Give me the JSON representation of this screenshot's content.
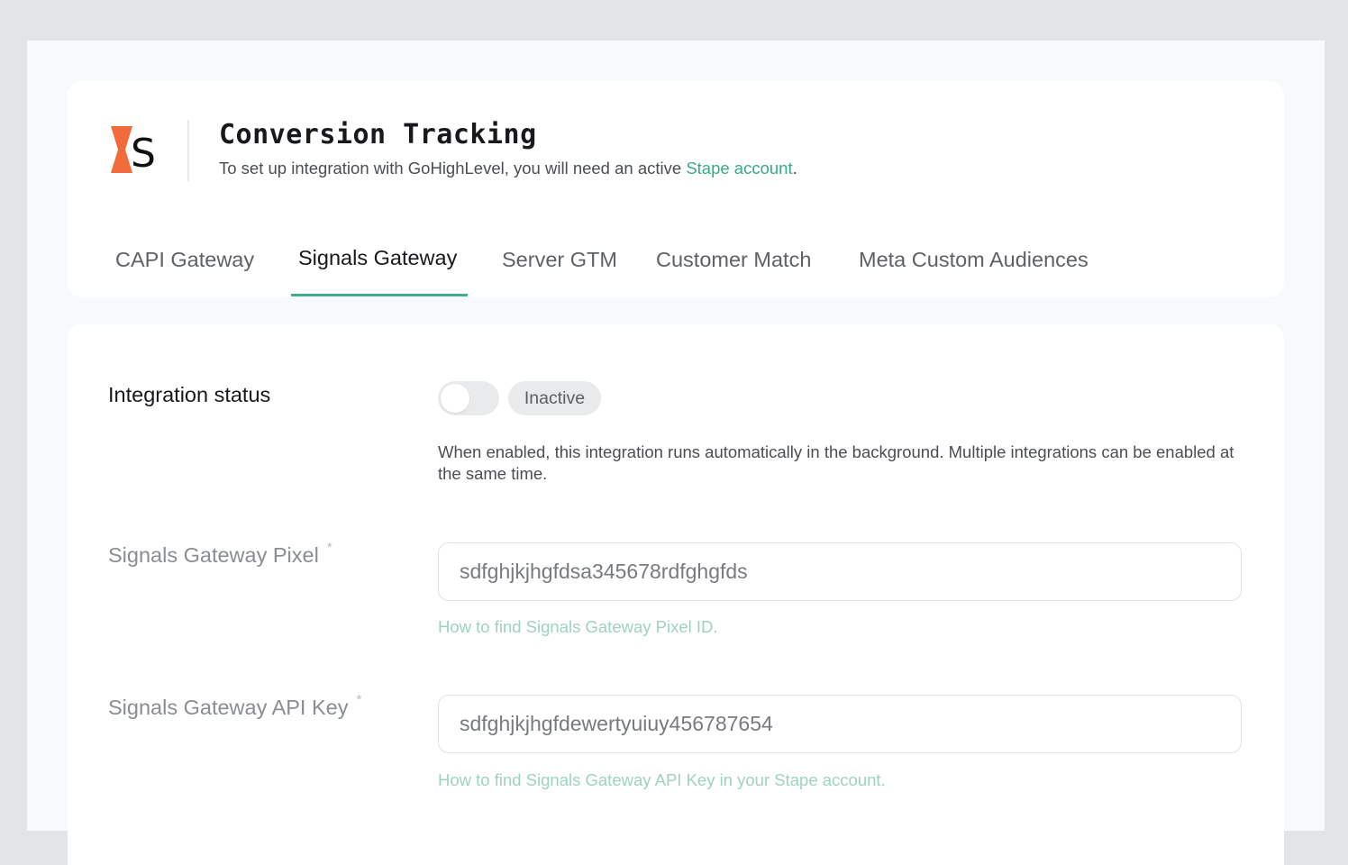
{
  "header": {
    "title": "Conversion Tracking",
    "subtitle_prefix": "To set up integration with GoHighLevel, you will need an active ",
    "subtitle_link": "Stape account",
    "subtitle_suffix": ".",
    "logo_icon": "stape-logo-icon"
  },
  "tabs": [
    {
      "label": "CAPI Gateway",
      "active": false
    },
    {
      "label": "Signals Gateway",
      "active": true
    },
    {
      "label": "Server GTM",
      "active": false
    },
    {
      "label": "Customer Match",
      "active": false
    },
    {
      "label": "Meta Custom Audiences",
      "active": false
    }
  ],
  "integration": {
    "label": "Integration status",
    "toggle_on": false,
    "status_badge": "Inactive",
    "help": "When enabled, this integration runs automatically in the background. Multiple integrations can be enabled at the same time."
  },
  "fields": {
    "pixel": {
      "label": "Signals Gateway Pixel",
      "required_mark": "*",
      "value": "sdfghjkjhgfdsa345678rdfghgfds",
      "help_link": "How to find Signals Gateway Pixel ID."
    },
    "api_key": {
      "label": "Signals Gateway API Key",
      "required_mark": "*",
      "value": "sdfghjkjhgfdewertyuiuy456787654",
      "help_link": "How to find Signals Gateway API Key in your Stape account."
    }
  },
  "colors": {
    "page_background": "#e1e5e8",
    "accent": "#3fb08e",
    "link": "#3aa985",
    "logo_orange": "#f26b3a"
  }
}
